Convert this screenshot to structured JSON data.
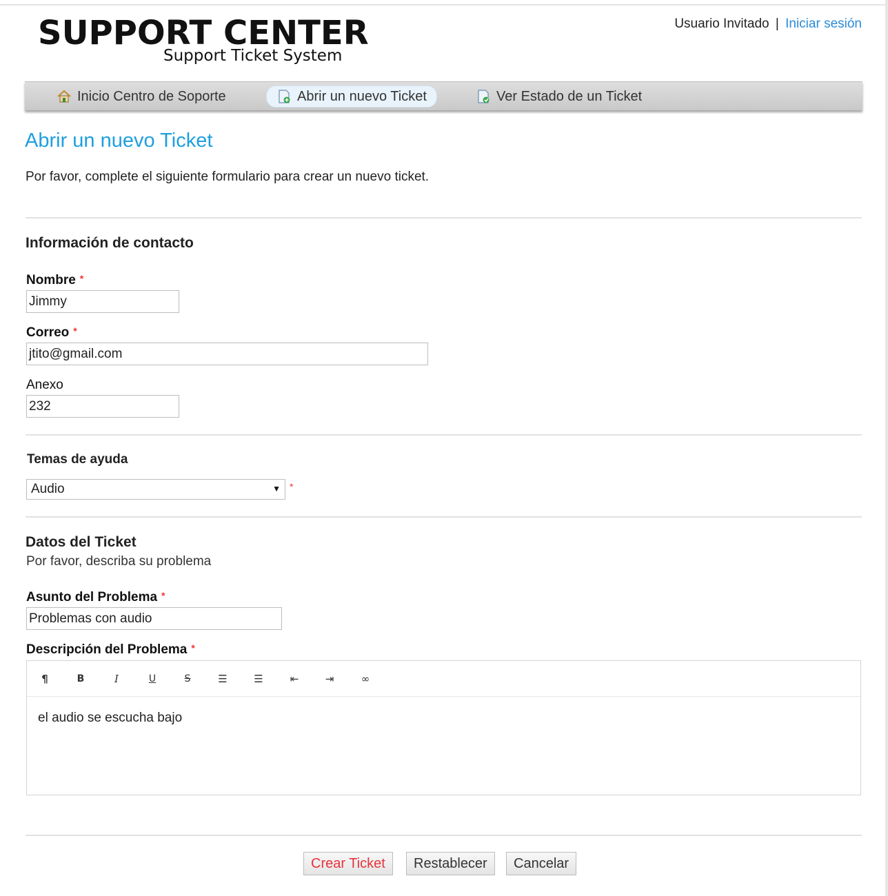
{
  "header": {
    "logo_title": "SUPPORT CENTER",
    "logo_subtitle": "Support Ticket System",
    "user_label": "Usuario Invitado",
    "separator": "|",
    "login_link": "Iniciar sesión"
  },
  "nav": {
    "items": [
      {
        "label": "Inicio Centro de Soporte",
        "icon": "home-icon"
      },
      {
        "label": "Abrir un nuevo Ticket",
        "icon": "new-ticket-icon",
        "active": true
      },
      {
        "label": "Ver Estado de un Ticket",
        "icon": "ticket-status-icon"
      }
    ]
  },
  "page": {
    "title": "Abrir un nuevo Ticket",
    "intro": "Por favor, complete el siguiente formulario para crear un nuevo ticket."
  },
  "contact": {
    "section_title": "Información de contacto",
    "name_label": "Nombre",
    "name_value": "Jimmy",
    "email_label": "Correo",
    "email_value": "jtito@gmail.com",
    "ext_label": "Anexo",
    "ext_value": "232",
    "required_mark": "*"
  },
  "help_topic": {
    "section_title": "Temas de ayuda",
    "selected": "Audio",
    "arrow": "▼",
    "required_mark": "*"
  },
  "ticket": {
    "section_title": "Datos del Ticket",
    "section_subtitle": "Por favor, describa su problema",
    "subject_label": "Asunto del Problema",
    "subject_value": "Problemas con audio",
    "description_label": "Descripción del Problema",
    "description_value": "el audio se escucha bajo",
    "required_mark": "*",
    "toolbar": [
      {
        "name": "paragraph-icon",
        "glyph": "¶"
      },
      {
        "name": "bold-icon",
        "glyph": "B"
      },
      {
        "name": "italic-icon",
        "glyph": "I"
      },
      {
        "name": "underline-icon",
        "glyph": "U"
      },
      {
        "name": "strikethrough-icon",
        "glyph": "S"
      },
      {
        "name": "unordered-list-icon",
        "glyph": "☰"
      },
      {
        "name": "ordered-list-icon",
        "glyph": "☰"
      },
      {
        "name": "outdent-icon",
        "glyph": "⇤"
      },
      {
        "name": "indent-icon",
        "glyph": "⇥"
      },
      {
        "name": "link-icon",
        "glyph": "∞"
      }
    ]
  },
  "actions": {
    "create": "Crear Ticket",
    "reset": "Restablecer",
    "cancel": "Cancelar"
  },
  "colors": {
    "accent": "#1e9fe0",
    "link": "#2a8bd6",
    "required": "#e33333",
    "primary_button_text": "#e8323a"
  }
}
